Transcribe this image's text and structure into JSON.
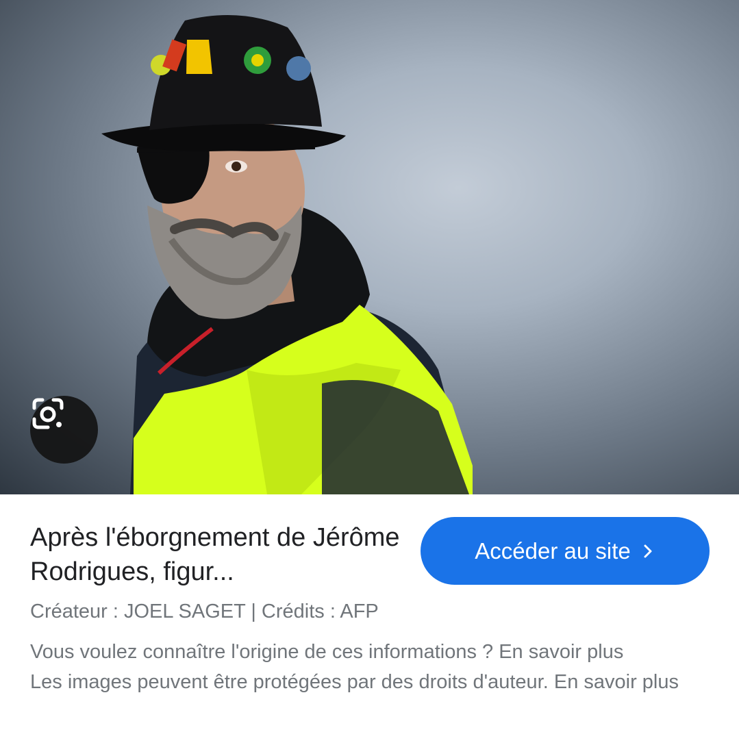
{
  "image": {
    "subject": "portrait-photo",
    "lens_icon": "google-lens-icon"
  },
  "result": {
    "title": "Après l'éborgnement de Jérôme Rodrigues, figur...",
    "visit_button_label": "Accéder au site",
    "visit_button_icon": "chevron-right-icon",
    "credits": "Créateur : JOEL SAGET | Crédits : AFP",
    "origin_notice": "Vous voulez connaître l'origine de ces informations ? En savoir plus",
    "copyright_notice": "Les images peuvent être protégées par des droits d'auteur. En savoir plus"
  },
  "colors": {
    "button_blue": "#1a73e8",
    "title_text": "#202124",
    "secondary_text": "#70757a",
    "vest_yellow": "#d6ff1c"
  }
}
